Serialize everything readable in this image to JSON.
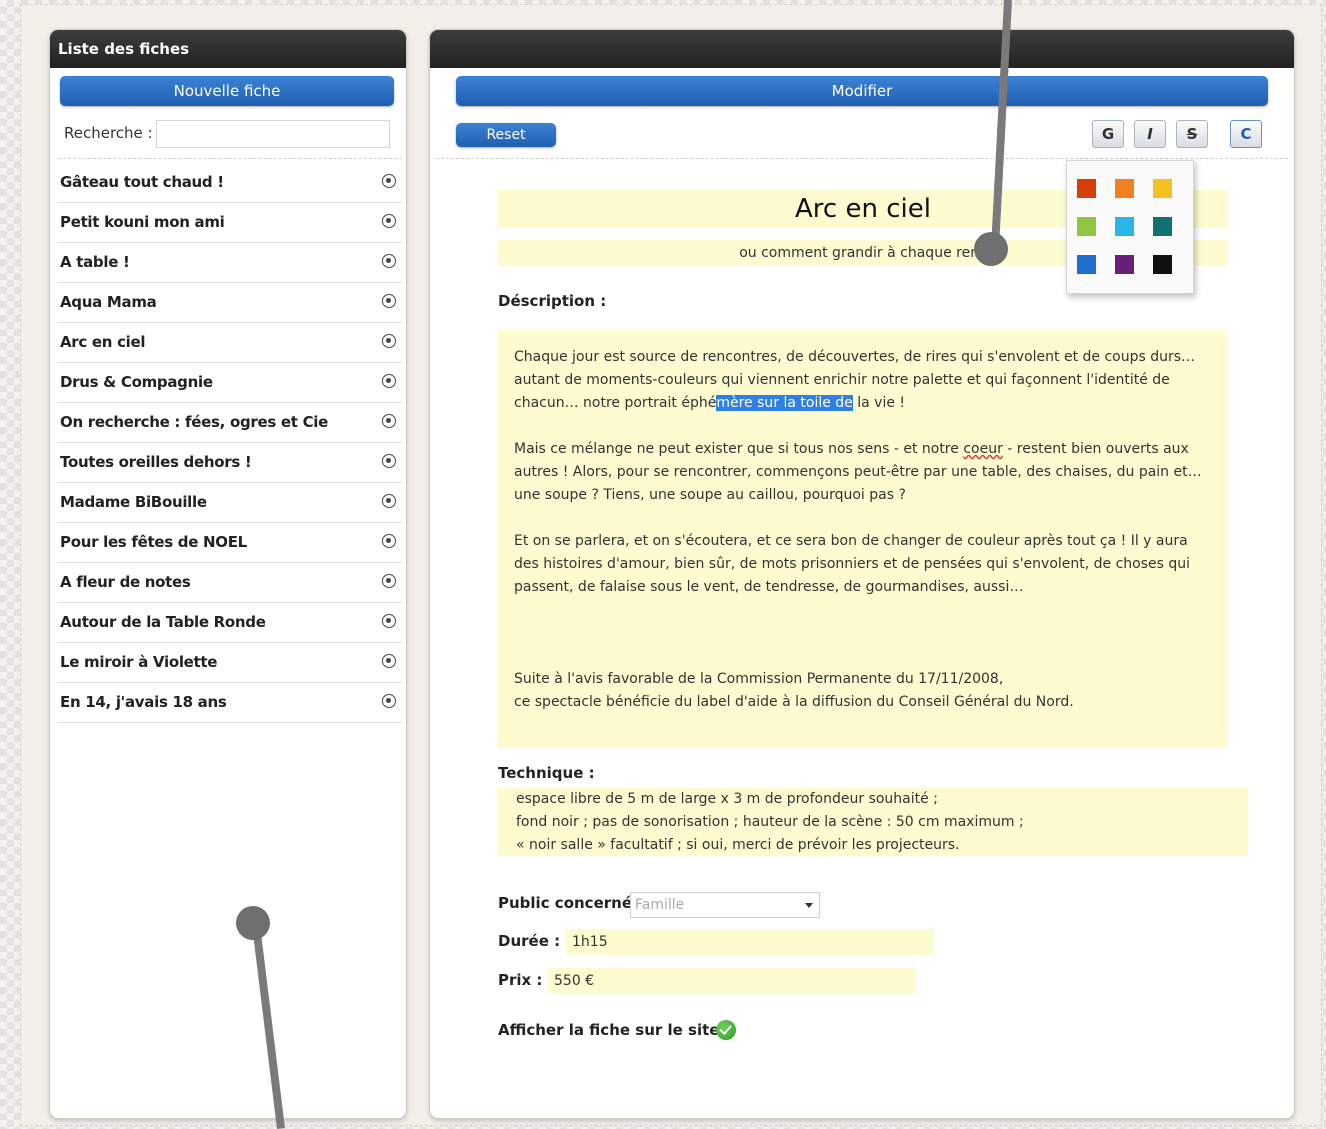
{
  "left_panel": {
    "title": "Liste des fiches",
    "new_button": "Nouvelle fiche",
    "search_label": "Recherche :",
    "search_value": "",
    "items": [
      "Gâteau tout chaud !",
      "Petit kouni mon ami",
      "A table !",
      "Aqua Mama",
      "Arc en ciel",
      "Drus & Compagnie",
      "On recherche : fées, ogres et Cie",
      "Toutes oreilles dehors !",
      "Madame BiBouille",
      "Pour les fêtes de NOEL",
      "A fleur de notes",
      "Autour de la Table Ronde",
      "Le miroir à Violette",
      "En 14, j'avais 18 ans"
    ]
  },
  "right_panel": {
    "modify_button": "Modifier",
    "reset_button": "Reset",
    "toolbar": {
      "bold": "G",
      "italic": "I",
      "strike": "S",
      "color": "C"
    },
    "palette_colors": [
      "#d43f0a",
      "#f08020",
      "#f5c020",
      "#8ec63f",
      "#29b6e8",
      "#127070",
      "#1f6fd0",
      "#6a1f7a",
      "#111111"
    ],
    "title": "Arc en ciel",
    "subtitle": "ou comment grandir à chaque renc",
    "description_label": "Déscription :",
    "description": {
      "p1_before": "Chaque jour est source de rencontres, de découvertes, de rires qui s'envolent et de coups durs… autant de moments-couleurs qui viennent enrichir notre palette et qui façonnent l'identité de chacun… notre portrait éphé",
      "p1_selected": "mère sur la toile de",
      "p1_after": " la vie !",
      "p2_before": "Mais ce mélange ne peut exister que si tous nos sens - et notre ",
      "p2_misspelled": "coeur",
      "p2_after": " - restent bien ouverts aux autres ! Alors, pour se rencontrer, commençons peut-être par une table, des chaises, du pain et… une soupe ? Tiens, une soupe au caillou, pourquoi pas ?",
      "p3": "Et on se parlera, et on s'écoutera, et ce sera bon de changer de couleur après tout ça ! Il y aura des histoires d'amour, bien sûr, de mots prisonniers et de pensées qui s'envolent, de choses qui passent, de falaise sous le vent, de tendresse, de gourmandises, aussi…",
      "p4_line1": "Suite à l'avis favorable de la Commission Permanente du 17/11/2008,",
      "p4_line2": "ce spectacle bénéficie du label d'aide à la diffusion du Conseil Général du Nord."
    },
    "technique_label": "Technique :",
    "technique_lines": [
      "espace libre de 5 m de large x 3 m de profondeur souhaité ;",
      "fond noir ; pas de sonorisation ; hauteur de la scène : 50 cm maximum ;",
      " « noir salle » facultatif ; si oui, merci de prévoir les projecteurs."
    ],
    "public_label": "Public concerné :",
    "public_value": "Famille",
    "duration_label": "Durée :",
    "duration_value": "1h15",
    "price_label": "Prix :",
    "price_value": "550 €",
    "publish_label": "Afficher la fiche sur le site :"
  }
}
